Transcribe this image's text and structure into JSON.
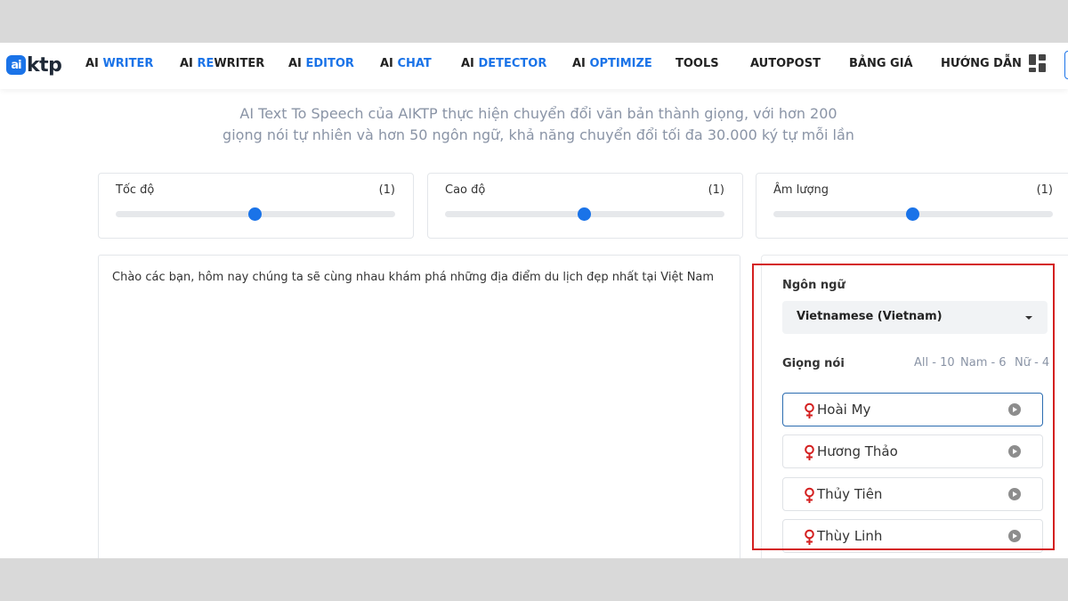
{
  "logo": {
    "badge": "ai",
    "text": "ktp"
  },
  "nav": [
    {
      "pre": "AI ",
      "hl": "WRITER"
    },
    {
      "pre": "AI ",
      "hl": "RE",
      "post": "WRITER"
    },
    {
      "pre": "AI ",
      "hl": "EDITOR"
    },
    {
      "pre": "AI ",
      "hl": "CHAT"
    },
    {
      "pre": "AI ",
      "hl": "DETECTOR"
    },
    {
      "pre": "AI ",
      "hl": "OPTIMIZE"
    },
    {
      "pre": "TOOLS"
    },
    {
      "pre": "AUTOPOST"
    },
    {
      "pre": "BẢNG GIÁ"
    },
    {
      "pre": "HƯỚNG DẪN"
    }
  ],
  "subtitle": {
    "line1": "AI Text To Speech của AIKTP thực hiện chuyển đổi văn bản thành giọng, với hơn 200",
    "line2": "giọng nói tự nhiên và hơn 50 ngôn ngữ, khả năng chuyển đổi tối đa 30.000 ký tự mỗi lần"
  },
  "sliders": [
    {
      "label": "Tốc độ",
      "value_text": "(1)",
      "level": 0.5
    },
    {
      "label": "Cao độ",
      "value_text": "(1)",
      "level": 0.5
    },
    {
      "label": "Âm lượng",
      "value_text": "(1)",
      "level": 0.5
    }
  ],
  "editor": {
    "text": "Chào các bạn, hôm nay chúng ta sẽ cùng nhau khám phá những địa điểm du lịch đẹp nhất tại Việt Nam"
  },
  "language": {
    "label": "Ngôn ngữ",
    "selected": "Vietnamese (Vietnam)"
  },
  "voices": {
    "label": "Giọng nói",
    "filters": {
      "all": "All - 10",
      "male": "Nam - 6",
      "female": "Nữ - 4"
    },
    "items": [
      {
        "name": "Hoài My",
        "active": true
      },
      {
        "name": "Hương Thảo",
        "active": false
      },
      {
        "name": "Thủy Tiên",
        "active": false
      },
      {
        "name": "Thùy Linh",
        "active": false
      }
    ]
  },
  "colors": {
    "accent": "#1a73e8",
    "highlight_box": "#d42020",
    "female_icon": "#d42020"
  }
}
